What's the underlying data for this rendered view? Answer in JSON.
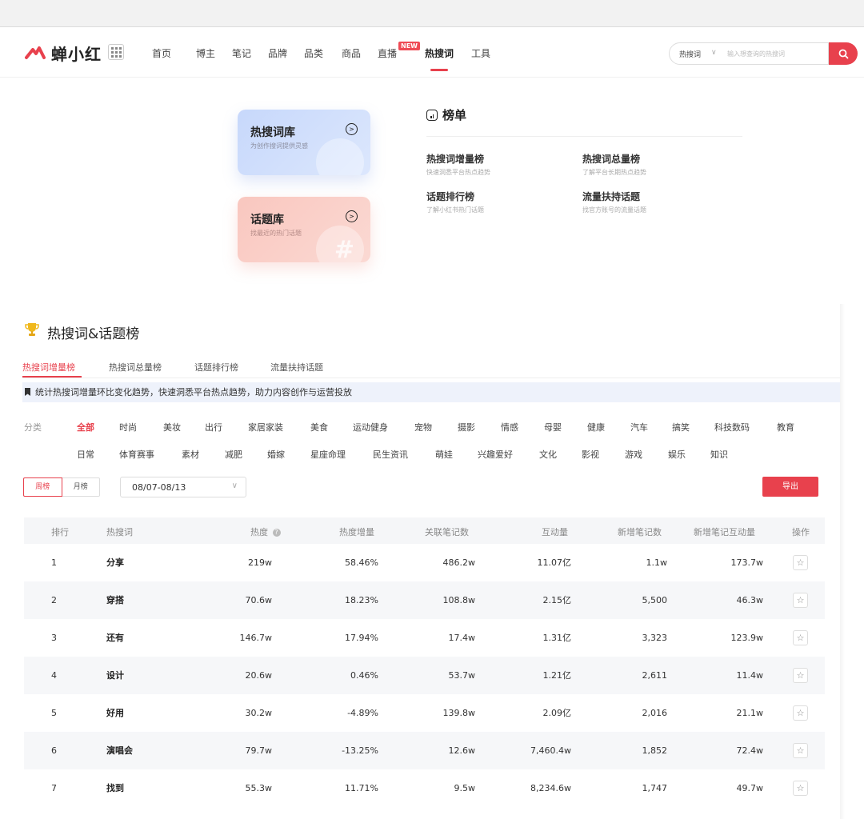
{
  "header": {
    "brand": "蝉小红",
    "nav": [
      "首页",
      "博主",
      "笔记",
      "品牌",
      "品类",
      "商品",
      "直播",
      "热搜词",
      "工具"
    ],
    "nav_active": "热搜词",
    "new_badge": "NEW",
    "search": {
      "type": "热搜词",
      "placeholder": "输入想查询的热搜词"
    }
  },
  "cards": [
    {
      "title": "热搜词库",
      "subtitle": "为创作搜词提供灵感"
    },
    {
      "title": "话题库",
      "subtitle": "找最近的热门话题"
    }
  ],
  "rank_board": {
    "title": "榜单",
    "items": [
      {
        "title": "热搜词增量榜",
        "desc": "快速洞悉平台热点趋势"
      },
      {
        "title": "热搜词总量榜",
        "desc": "了解平台长期热点趋势"
      },
      {
        "title": "话题排行榜",
        "desc": "了解小红书热门话题"
      },
      {
        "title": "流量扶持话题",
        "desc": "找官方账号的流量话题"
      }
    ]
  },
  "panel": {
    "title": "热搜词&话题榜",
    "tabs": [
      "热搜词增量榜",
      "热搜词总量榜",
      "话题排行榜",
      "流量扶持话题"
    ],
    "active_tab": "热搜词增量榜",
    "notice": "统计热搜词增量环比变化趋势，快速洞悉平台热点趋势，助力内容创作与运营投放",
    "category_label": "分类",
    "categories_row1": [
      "全部",
      "时尚",
      "美妆",
      "出行",
      "家居家装",
      "美食",
      "运动健身",
      "宠物",
      "摄影",
      "情感",
      "母婴",
      "健康",
      "汽车",
      "搞笑",
      "科技数码",
      "教育"
    ],
    "categories_row2": [
      "日常",
      "体育赛事",
      "素材",
      "减肥",
      "婚嫁",
      "星座命理",
      "民生资讯",
      "萌娃",
      "兴趣爱好",
      "文化",
      "影视",
      "游戏",
      "娱乐",
      "知识"
    ],
    "active_category": "全部",
    "period_options": [
      "周榜",
      "月榜"
    ],
    "period_selected": "周榜",
    "date_range": "08/07-08/13",
    "export_label": "导出"
  },
  "table": {
    "columns": [
      "排行",
      "热搜词",
      "热度",
      "热度增量",
      "关联笔记数",
      "互动量",
      "新增笔记数",
      "新增笔记互动量",
      "操作"
    ],
    "rows": [
      {
        "rank": "1",
        "word": "分享",
        "heat": "219w",
        "heat_growth": "58.46%",
        "related_notes": "486.2w",
        "interactions": "11.07亿",
        "new_notes": "1.1w",
        "new_note_interactions": "173.7w"
      },
      {
        "rank": "2",
        "word": "穿搭",
        "heat": "70.6w",
        "heat_growth": "18.23%",
        "related_notes": "108.8w",
        "interactions": "2.15亿",
        "new_notes": "5,500",
        "new_note_interactions": "46.3w"
      },
      {
        "rank": "3",
        "word": "还有",
        "heat": "146.7w",
        "heat_growth": "17.94%",
        "related_notes": "17.4w",
        "interactions": "1.31亿",
        "new_notes": "3,323",
        "new_note_interactions": "123.9w"
      },
      {
        "rank": "4",
        "word": "设计",
        "heat": "20.6w",
        "heat_growth": "0.46%",
        "related_notes": "53.7w",
        "interactions": "1.21亿",
        "new_notes": "2,611",
        "new_note_interactions": "11.4w"
      },
      {
        "rank": "5",
        "word": "好用",
        "heat": "30.2w",
        "heat_growth": "-4.89%",
        "related_notes": "139.8w",
        "interactions": "2.09亿",
        "new_notes": "2,016",
        "new_note_interactions": "21.1w"
      },
      {
        "rank": "6",
        "word": "演唱会",
        "heat": "79.7w",
        "heat_growth": "-13.25%",
        "related_notes": "12.6w",
        "interactions": "7,460.4w",
        "new_notes": "1,852",
        "new_note_interactions": "72.4w"
      },
      {
        "rank": "7",
        "word": "找到",
        "heat": "55.3w",
        "heat_growth": "11.71%",
        "related_notes": "9.5w",
        "interactions": "8,234.6w",
        "new_notes": "1,747",
        "new_note_interactions": "49.7w"
      }
    ]
  },
  "colors": {
    "accent": "#e8414d",
    "card_blue": "#c7d8fb",
    "card_red": "#f9c7bf",
    "notice_bg": "#eef2fb",
    "row_alt": "#f6f7f9"
  },
  "icons": {
    "logo": "brand-logo-icon",
    "apps": "apps-grid-icon",
    "search": "search-icon",
    "card_arrow": "arrow-right-circle-icon",
    "rank": "chart-board-icon",
    "trophy": "trophy-icon",
    "notice": "bookmark-icon",
    "heat_help": "help-icon",
    "date_caret": "chevron-down-icon",
    "favorite": "star-icon"
  }
}
